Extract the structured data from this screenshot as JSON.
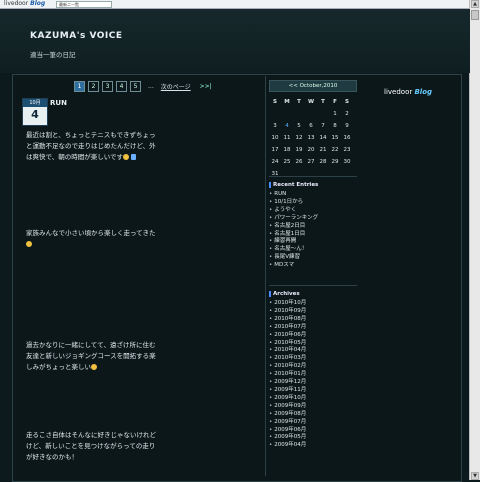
{
  "toolbar": {
    "logo_text": "livedoor",
    "logo_accent": "Blog",
    "selector_value": "最新ニ一覧"
  },
  "header": {
    "title": "KAZUMA's VOICE",
    "subtitle": "適当一筆の日記"
  },
  "pager": {
    "pages": [
      "1",
      "2",
      "3",
      "4",
      "5"
    ],
    "current": "1",
    "dots": "...",
    "next": "次のページ",
    "last": ">>|"
  },
  "entry": {
    "month": "10月",
    "day": "4",
    "title": "RUN",
    "paragraphs": [
      "最近は割と、ちょっとテニスもできずちょっと運動不足なので走りはじめたんだけど、外は爽快で、朝の時間が楽しいです",
      "家族みんなで小さい頃から楽しく走ってきた",
      "過去かなりに一緒にしてて、遠ざけ所に住む友達と新しいジョギングコースを開拓する楽しみがちょっと楽しい",
      "走るこさ自体はそんなに好きじゃないけれどけど、新しいことを見つけながらっての走りが好きなのかも！"
    ]
  },
  "calendar": {
    "prev": "<<",
    "month_label": "October,2010",
    "weekdays": [
      "S",
      "M",
      "T",
      "W",
      "T",
      "F",
      "S"
    ],
    "days": [
      "",
      "",
      "",
      "",
      "",
      "1",
      "2",
      "3",
      "4",
      "5",
      "6",
      "7",
      "8",
      "9",
      "10",
      "11",
      "12",
      "13",
      "14",
      "15",
      "16",
      "17",
      "18",
      "19",
      "20",
      "21",
      "22",
      "23",
      "24",
      "25",
      "26",
      "27",
      "28",
      "29",
      "30",
      "31",
      "",
      "",
      "",
      "",
      "",
      ""
    ]
  },
  "blog_logo": {
    "text": "livedoor",
    "accent": "Blog"
  },
  "recent_entries": {
    "heading": "Recent Entries",
    "items": [
      "RUN",
      "10/1日から",
      "ようやく",
      "パワーランキング",
      "名古屋2日目",
      "名古屋1日目",
      "練習再開",
      "名古屋〜ん！",
      "長尾V練習",
      "MDスマ"
    ]
  },
  "archives": {
    "heading": "Archives",
    "items": [
      "2010年10月",
      "2010年09月",
      "2010年08月",
      "2010年07月",
      "2010年06月",
      "2010年05月",
      "2010年04月",
      "2010年03月",
      "2010年02月",
      "2010年01月",
      "2009年12月",
      "2009年11月",
      "2009年10月",
      "2009年09月",
      "2009年08月",
      "2009年07月",
      "2009年06月",
      "2009年05月",
      "2009年04月"
    ]
  }
}
